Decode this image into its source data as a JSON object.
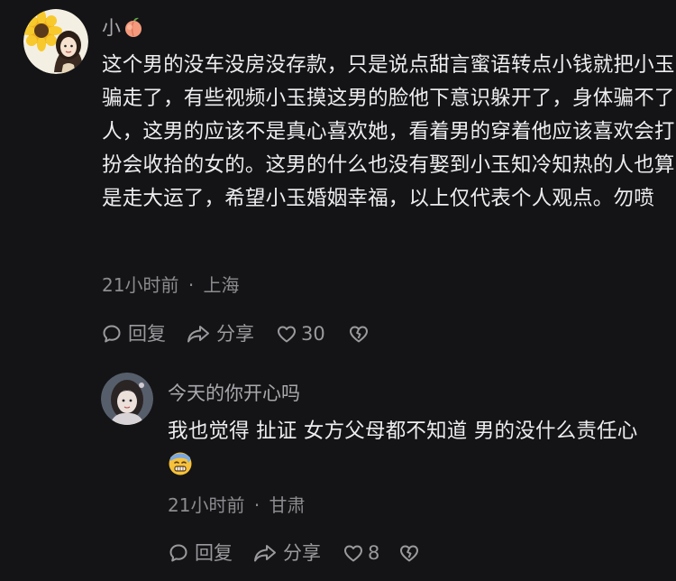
{
  "comment": {
    "author": "小",
    "author_emoji": "peach-emoji",
    "text": "这个男的没车没房没存款，只是说点甜言蜜语转点小钱就把小玉骗走了，有些视频小玉摸这男的脸他下意识躲开了，身体骗不了人，这男的应该不是真心喜欢她，看着男的穿着他应该喜欢会打扮会收拾的女的。这男的什么也没有娶到小玉知冷知热的人也算是走大运了，希望小玉婚姻幸福，以上仅代表个人观点。勿喷",
    "time": "21小时前",
    "separator": "·",
    "location": "上海",
    "reply_label": "回复",
    "share_label": "分享",
    "like_count": "30",
    "reply": {
      "author": "今天的你开心吗",
      "text": "我也觉得 扯证 女方父母都不知道 男的没什么责任心",
      "text_emoji": "cold-sweat-emoji",
      "time": "21小时前",
      "separator": "·",
      "location": "甘肃",
      "reply_label": "回复",
      "share_label": "分享",
      "like_count": "8"
    }
  },
  "colors": {
    "background": "#141416",
    "primary_text": "#ededef",
    "secondary_text": "#8c8c90",
    "icon": "#9a9a9e"
  }
}
